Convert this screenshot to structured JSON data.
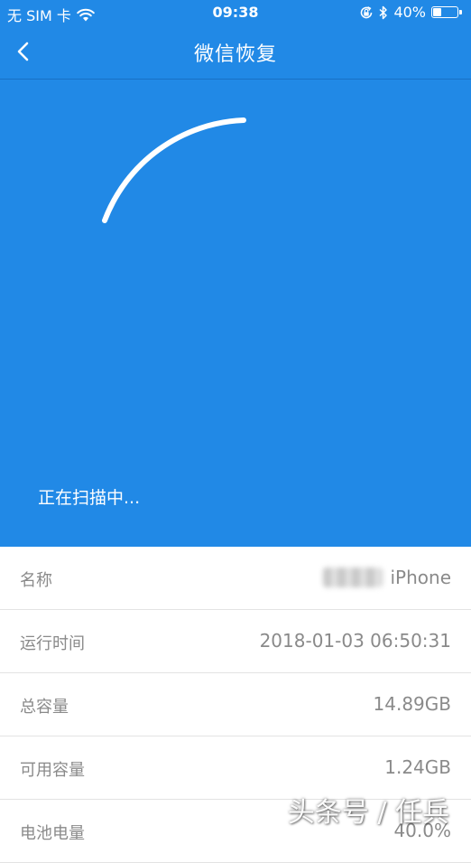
{
  "status_bar": {
    "carrier": "无 SIM 卡",
    "time": "09:38",
    "battery_percent": "40%",
    "battery_level": 0.4,
    "icons": [
      "wifi-icon",
      "orientation-lock-icon",
      "bluetooth-icon",
      "battery-icon"
    ]
  },
  "nav": {
    "title": "微信恢复",
    "back_icon": "chevron-left-icon"
  },
  "scan": {
    "status_text": "正在扫描中...",
    "accent_color": "#2189e6"
  },
  "device_info": [
    {
      "label": "名称",
      "value": "iPhone"
    },
    {
      "label": "运行时间",
      "value": "2018-01-03 06:50:31"
    },
    {
      "label": "总容量",
      "value": "14.89GB"
    },
    {
      "label": "可用容量",
      "value": "1.24GB"
    },
    {
      "label": "电池电量",
      "value": "40.0%"
    }
  ],
  "watermark": "头条号 / 任兵"
}
